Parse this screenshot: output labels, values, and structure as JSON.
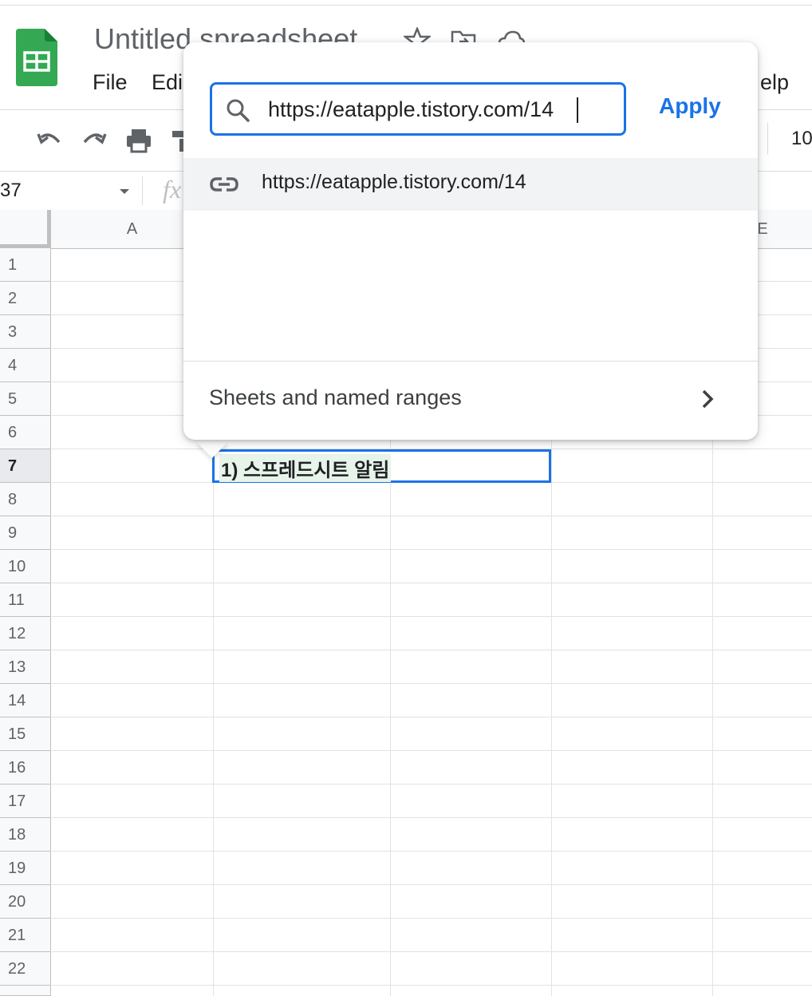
{
  "app": {
    "doc_title": "Untitled spreadsheet",
    "menu": [
      "File",
      "Edi",
      "elp"
    ]
  },
  "toolbar": {
    "font_size": "10"
  },
  "formula_bar": {
    "name_box": "37",
    "fx_label": "fx"
  },
  "grid": {
    "columns": [
      "A",
      "E"
    ],
    "rows": [
      "1",
      "2",
      "3",
      "4",
      "5",
      "6",
      "7",
      "8",
      "9",
      "10",
      "11",
      "12",
      "13",
      "14",
      "15",
      "16",
      "17",
      "18",
      "19",
      "20",
      "21",
      "22"
    ],
    "active_row": "7",
    "selected_cell_text": "1) 스프레드시트 알림"
  },
  "link_popup": {
    "search_value": "https://eatapple.tistory.com/14",
    "apply_label": "Apply",
    "suggestion": "https://eatapple.tistory.com/14",
    "sheets_ranges_label": "Sheets and named ranges"
  },
  "colors": {
    "accent": "#1a73e8",
    "sheets_green": "#34a853",
    "cell_highlight": "#e6f4ea"
  },
  "icons": [
    "sheets-logo-icon",
    "star-icon",
    "move-to-folder-icon",
    "cloud-status-icon",
    "undo-icon",
    "redo-icon",
    "print-icon",
    "paint-format-icon",
    "search-icon",
    "link-icon",
    "chevron-right-icon",
    "dropdown-caret-icon"
  ]
}
